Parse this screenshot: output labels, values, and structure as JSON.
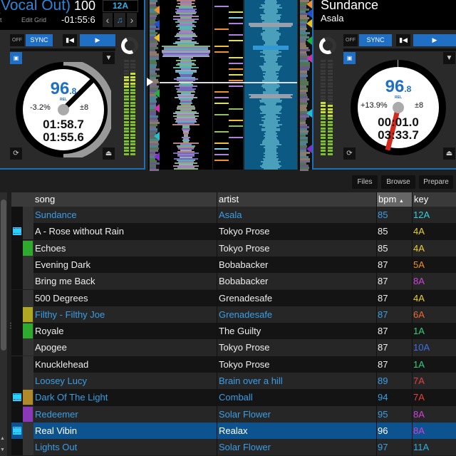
{
  "colors": {
    "accent": "#1f6fc4",
    "link_blue": "#3a9ee6",
    "selected_row": "#0d5390",
    "needle_left": "#000000",
    "needle_right": "#d42a1e"
  },
  "deck_left": {
    "title": "(Vocal Out)",
    "bpm": "100",
    "beat_label": "eat",
    "edit_grid_label": "Edit Grid",
    "remaining_time": "-01:55:6",
    "key": "12A",
    "key_prev_icon": "chevron-left-icon",
    "key_lock_icon": "music-note-icon",
    "key_next_icon": "chevron-right-icon",
    "off_label": "OFF",
    "sync_label": "SYNC",
    "platter": {
      "bpm_int": "96",
      "bpm_dec": ".8",
      "rel_label": "REL",
      "pitch_pct": "-3.2%",
      "pitch_range": "±8",
      "elapsed": "01:58.7",
      "remaining": "01:55.6"
    }
  },
  "deck_right": {
    "title": "Sundance",
    "artist": "Asala",
    "off_label": "OFF",
    "sync_label": "SYNC",
    "platter": {
      "bpm_int": "96",
      "bpm_dec": ".8",
      "rel_label": "REL",
      "pitch_pct": "+13.9%",
      "pitch_range": "±8",
      "elapsed": "00:01.0",
      "remaining": "03:33.7"
    }
  },
  "browser": {
    "buttons": [
      "Files",
      "Browse",
      "Prepare"
    ],
    "columns": {
      "song": "song",
      "artist": "artist",
      "bpm": "bpm",
      "bpm_sort_icon": "▲",
      "key": "key"
    },
    "rows": [
      {
        "song": "Sundance",
        "artist": "Asala",
        "bpm": "85",
        "key": "12A",
        "key_color": "#2fd0d8",
        "played": true,
        "video": false,
        "color_tag": null
      },
      {
        "song": "A - Rose without Rain",
        "artist": "Tokyo Prose",
        "bpm": "85",
        "key": "4A",
        "key_color": "#e8d030",
        "played": false,
        "video": true,
        "color_tag": null
      },
      {
        "song": "Echoes",
        "artist": "Tokyo Prose",
        "bpm": "85",
        "key": "4A",
        "key_color": "#e8d030",
        "played": false,
        "video": false,
        "color_tag": "#2eaa2e"
      },
      {
        "song": "Evening Dark",
        "artist": "Bobabacker",
        "bpm": "87",
        "key": "5A",
        "key_color": "#f0902a",
        "played": false,
        "video": false,
        "color_tag": null
      },
      {
        "song": "Bring me Back",
        "artist": "Bobabacker",
        "bpm": "87",
        "key": "8A",
        "key_color": "#d040d8",
        "played": false,
        "video": false,
        "color_tag": null
      },
      {
        "song": "500 Degrees",
        "artist": "Grenadesafe",
        "bpm": "87",
        "key": "4A",
        "key_color": "#e8d030",
        "played": false,
        "video": false,
        "color_tag": null
      },
      {
        "song": "Filthy - Filthy Joe",
        "artist": "Grenadesafe",
        "bpm": "87",
        "key": "6A",
        "key_color": "#f06830",
        "played": true,
        "video": false,
        "color_tag": "#b0a820"
      },
      {
        "song": "Royale",
        "artist": "The Guilty",
        "bpm": "87",
        "key": "1A",
        "key_color": "#30d080",
        "played": false,
        "video": false,
        "color_tag": "#2eaa2e"
      },
      {
        "song": "Apogee",
        "artist": "Tokyo Prose",
        "bpm": "87",
        "key": "10A",
        "key_color": "#4070e0",
        "played": false,
        "video": false,
        "color_tag": null
      },
      {
        "song": "Knucklehead",
        "artist": "Tokyo Prose",
        "bpm": "87",
        "key": "1A",
        "key_color": "#30d080",
        "played": false,
        "video": false,
        "color_tag": null
      },
      {
        "song": "Loosey Lucy",
        "artist": "Brain over a hill",
        "bpm": "89",
        "key": "7A",
        "key_color": "#e84040",
        "played": true,
        "video": false,
        "color_tag": null
      },
      {
        "song": "Dark Of The Light",
        "artist": "Comball",
        "bpm": "94",
        "key": "7A",
        "key_color": "#e84040",
        "played": true,
        "video": true,
        "color_tag": "#b08a2a"
      },
      {
        "song": "Redeemer",
        "artist": "Solar Flower",
        "bpm": "95",
        "key": "8A",
        "key_color": "#d040d8",
        "played": true,
        "video": false,
        "color_tag": "#8a38b8"
      },
      {
        "song": "Real Vibin",
        "artist": "Realax",
        "bpm": "96",
        "key": "8A",
        "key_color": "#d040d8",
        "played": false,
        "video": true,
        "color_tag": null,
        "selected": true
      },
      {
        "song": "Lights Out",
        "artist": "Solar Flower",
        "bpm": "97",
        "key": "11A",
        "key_color": "#2fb0e0",
        "played": true,
        "video": false,
        "color_tag": null
      }
    ]
  }
}
